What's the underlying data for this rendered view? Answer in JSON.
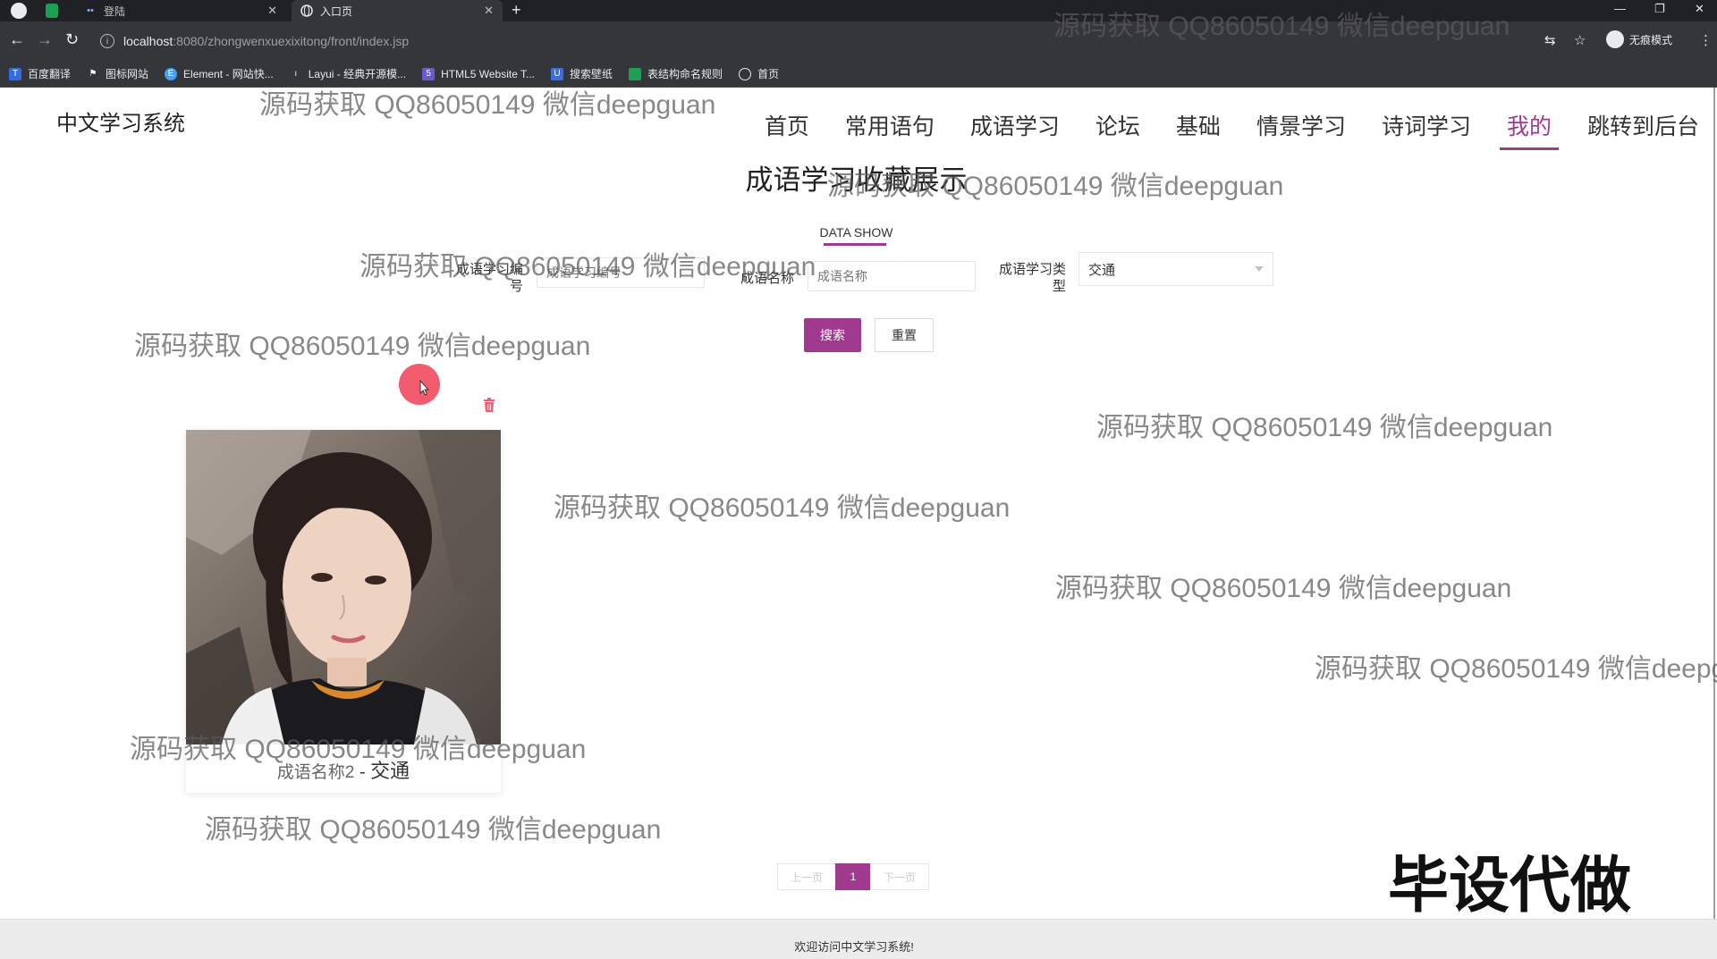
{
  "browser": {
    "tabs": [
      {
        "title": "登陆",
        "icon": "grid-icon"
      },
      {
        "title": "入口页",
        "icon": "globe-icon"
      }
    ],
    "url_host": "localhost",
    "url_rest": ":8080/zhongwenxuexixitong/front/index.jsp",
    "incognito_label": "无痕模式",
    "bookmarks": [
      {
        "label": "百度翻译",
        "icon": "translate-icon",
        "color": "#2f6de1"
      },
      {
        "label": "图标网站",
        "icon": "flag-icon",
        "color": "#ffffff"
      },
      {
        "label": "Element - 网站快...",
        "icon": "element-icon",
        "color": "#409eff"
      },
      {
        "label": "Layui - 经典开源模...",
        "icon": "layui-icon",
        "color": "#e8eaed"
      },
      {
        "label": "HTML5 Website T...",
        "icon": "html5-icon",
        "color": "#6a5acd"
      },
      {
        "label": "搜索壁纸",
        "icon": "wallpaper-icon",
        "color": "#3b6fe0"
      },
      {
        "label": "表结构命名规则",
        "icon": "sheet-icon",
        "color": "#1e9e55"
      },
      {
        "label": "首页",
        "icon": "globe-icon",
        "color": "#e8eaed"
      }
    ]
  },
  "site": {
    "brand": "中文学习系统",
    "nav": [
      "首页",
      "常用语句",
      "成语学习",
      "论坛",
      "基础",
      "情景学习",
      "诗词学习",
      "我的",
      "跳转到后台"
    ],
    "active_nav": "我的",
    "accent": "#a03a8e"
  },
  "section": {
    "title": "成语学习收藏展示",
    "subtitle": "DATA SHOW"
  },
  "filters": {
    "code_label_1": "成语学习编",
    "code_label_2": "号",
    "code_placeholder": "成语学习编号",
    "name_label": "成语名称",
    "name_placeholder": "成语名称",
    "type_label_1": "成语学习类",
    "type_label_2": "型",
    "type_value": "交通",
    "search_button": "搜索",
    "reset_button": "重置"
  },
  "cards": [
    {
      "name": "成语名称2",
      "separator": "-",
      "type": "交通"
    }
  ],
  "pager": {
    "prev": "上一页",
    "current": "1",
    "next": "下一页"
  },
  "footer": "欢迎访问中文学习系统!",
  "watermark": "源码获取 QQ86050149 微信deepguan",
  "overlay_stamp": "毕设代做"
}
